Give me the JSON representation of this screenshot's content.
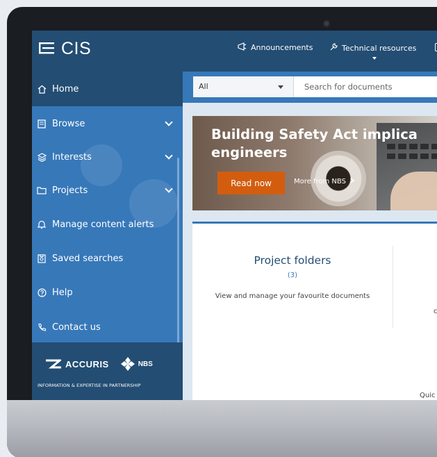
{
  "app": {
    "title": "CIS"
  },
  "header": {
    "links": [
      {
        "label": "Announcements",
        "icon": "megaphone-icon"
      },
      {
        "label": "Technical resources",
        "icon": "wrench-icon"
      }
    ]
  },
  "sidebar": {
    "items": [
      {
        "label": "Home",
        "icon": "home-icon",
        "active": true,
        "expandable": false
      },
      {
        "label": "Browse",
        "icon": "document-icon",
        "active": false,
        "expandable": true
      },
      {
        "label": "Interests",
        "icon": "layers-icon",
        "active": false,
        "expandable": true
      },
      {
        "label": "Projects",
        "icon": "folder-icon",
        "active": false,
        "expandable": true
      },
      {
        "label": "Manage content alerts",
        "icon": "bell-icon",
        "active": false,
        "expandable": false
      },
      {
        "label": "Saved searches",
        "icon": "saved-search-icon",
        "active": false,
        "expandable": false
      },
      {
        "label": "Help",
        "icon": "help-icon",
        "active": false,
        "expandable": false
      },
      {
        "label": "Contact us",
        "icon": "phone-icon",
        "active": false,
        "expandable": false
      }
    ],
    "partner": {
      "accuris": "ACCURIS",
      "nbs": "NBS",
      "tagline": "INFORMATION & EXPERTISE IN PARTNERSHIP"
    }
  },
  "search": {
    "scope_value": "All",
    "placeholder": "Search for documents"
  },
  "banner": {
    "title": "Building Safety Act implica\nengineers",
    "read_now_label": "Read now",
    "more_label": "More from NBS"
  },
  "card": {
    "folders_title": "Project folders",
    "folders_count": "(3)",
    "folders_desc": "View and manage your favourite documents",
    "right_cut_char": "c",
    "quick_label": "Quic"
  },
  "colors": {
    "header_dark": "#234d73",
    "sidebar_blue": "#3778b9",
    "accent_orange": "#d35d0f"
  }
}
